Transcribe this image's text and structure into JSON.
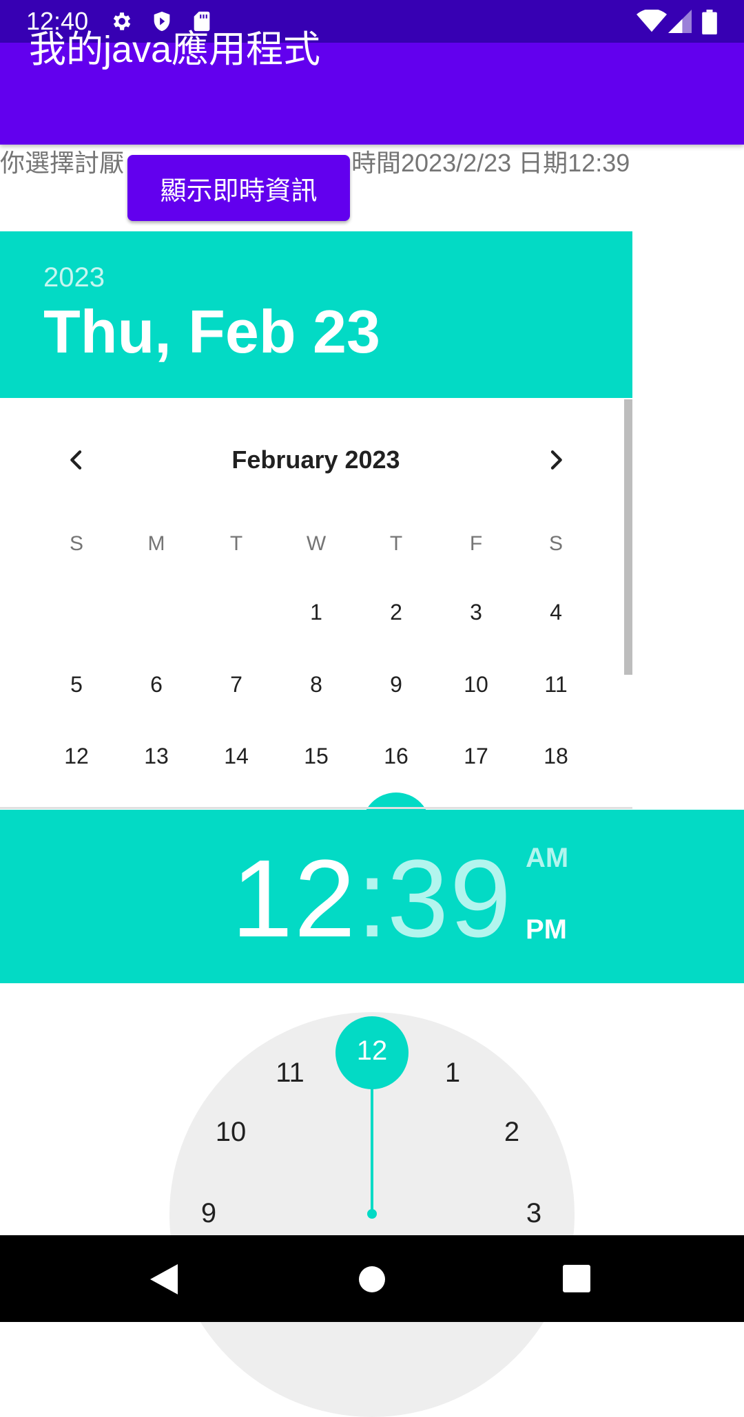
{
  "status_bar": {
    "time": "12:40",
    "left_icons": [
      "gear-icon",
      "shield-play-icon",
      "sd-card-icon"
    ],
    "right_icons": [
      "wifi-icon",
      "signal-icon",
      "battery-icon"
    ]
  },
  "app_bar": {
    "title": "我的java應用程式"
  },
  "info": {
    "text_left": "你選擇討厭",
    "text_right": "時間2023/2/23 日期12:39",
    "button_label": "顯示即時資訊"
  },
  "date_picker": {
    "year": "2023",
    "selected_date": "Thu, Feb 23",
    "month_title": "February 2023",
    "weekdays": [
      "S",
      "M",
      "T",
      "W",
      "T",
      "F",
      "S"
    ],
    "weeks": [
      [
        "",
        "",
        "",
        "1",
        "2",
        "3",
        "4"
      ],
      [
        "5",
        "6",
        "7",
        "8",
        "9",
        "10",
        "11"
      ],
      [
        "12",
        "13",
        "14",
        "15",
        "16",
        "17",
        "18"
      ]
    ]
  },
  "time_picker": {
    "hour": "12",
    "separator": ":",
    "minute": "39",
    "am": "AM",
    "pm": "PM",
    "selected_period": "PM",
    "clock_numbers": [
      "12",
      "1",
      "2",
      "3",
      "9",
      "10",
      "11"
    ],
    "selected_hour": "12"
  },
  "colors": {
    "status_bar": "#3700B3",
    "primary": "#6200EE",
    "accent": "#03DAC5"
  },
  "nav_bar": {
    "icons": [
      "back-icon",
      "home-icon",
      "recents-icon"
    ]
  }
}
